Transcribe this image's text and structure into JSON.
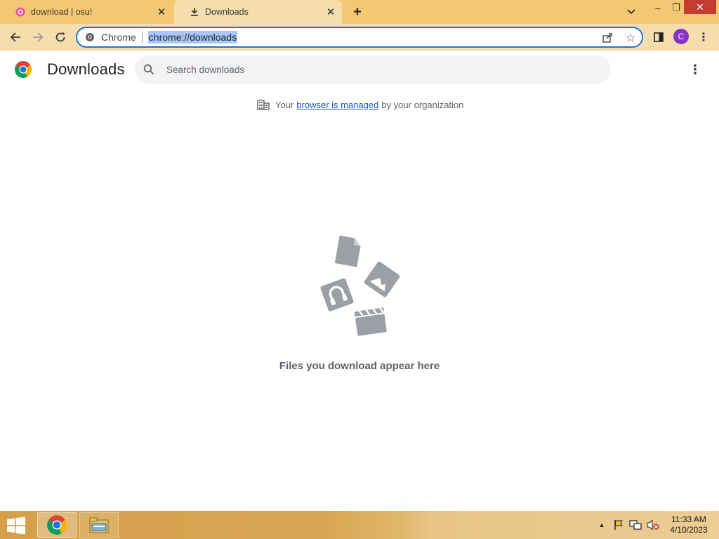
{
  "tabs": [
    {
      "title": "download | osu!",
      "icon": "osu-icon",
      "active": false
    },
    {
      "title": "Downloads",
      "icon": "download-icon",
      "active": true
    }
  ],
  "window_controls": {
    "minimize": "–",
    "restore": "❐",
    "close": "✕"
  },
  "toolbar": {
    "omnibox_chip": "Chrome",
    "url": "chrome://downloads",
    "profile_initial": "C"
  },
  "page": {
    "title": "Downloads",
    "search_placeholder": "Search downloads",
    "managed_prefix": "Your",
    "managed_link": "browser is managed",
    "managed_suffix": "by your organization",
    "empty_message": "Files you download appear here"
  },
  "taskbar": {
    "time": "11:33 AM",
    "date": "4/10/2023"
  },
  "colors": {
    "tabstrip": "#f4c872",
    "active_tab": "#f5deae",
    "accent": "#1a73e8",
    "profile": "#8a2fc7",
    "close_button": "#c43b2f"
  }
}
